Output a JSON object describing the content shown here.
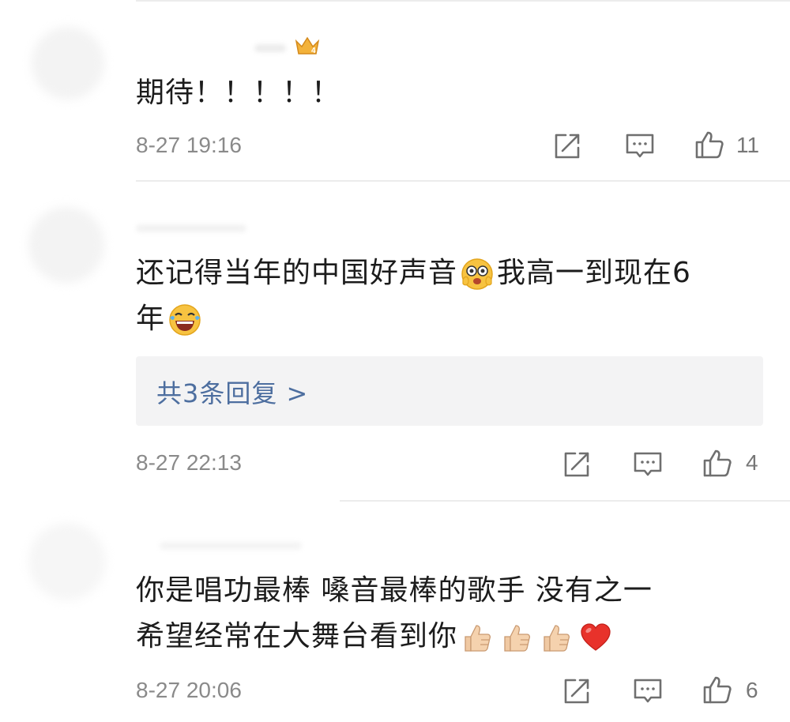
{
  "comments": [
    {
      "text_lines": [
        "期待！！！！！"
      ],
      "time": "8-27 19:16",
      "likes": "11"
    },
    {
      "text_lines": [
        "还记得当年的中国好声音",
        "我高一到现在6",
        "年"
      ],
      "emojis": [
        "amazed-face-emoji",
        "laughing-tears-emoji"
      ],
      "replies_label": "共3条回复 >",
      "time": "8-27 22:13",
      "likes": "4"
    },
    {
      "text_lines": [
        "你是唱功最棒  嗓音最棒的歌手  没有之一",
        "希望经常在大舞台看到你"
      ],
      "emojis": [
        "thumbs-up-emoji",
        "thumbs-up-emoji",
        "thumbs-up-emoji",
        "red-heart-emoji"
      ],
      "time": "8-27 20:06",
      "likes": "6"
    }
  ],
  "icons": {
    "share": "share-icon",
    "comment": "comment-icon",
    "like": "like-icon",
    "vip": "crown-badge-icon"
  },
  "colors": {
    "link": "#4d6e9f",
    "timestamp": "#8a8a8a",
    "reply_background": "#f3f3f4"
  }
}
